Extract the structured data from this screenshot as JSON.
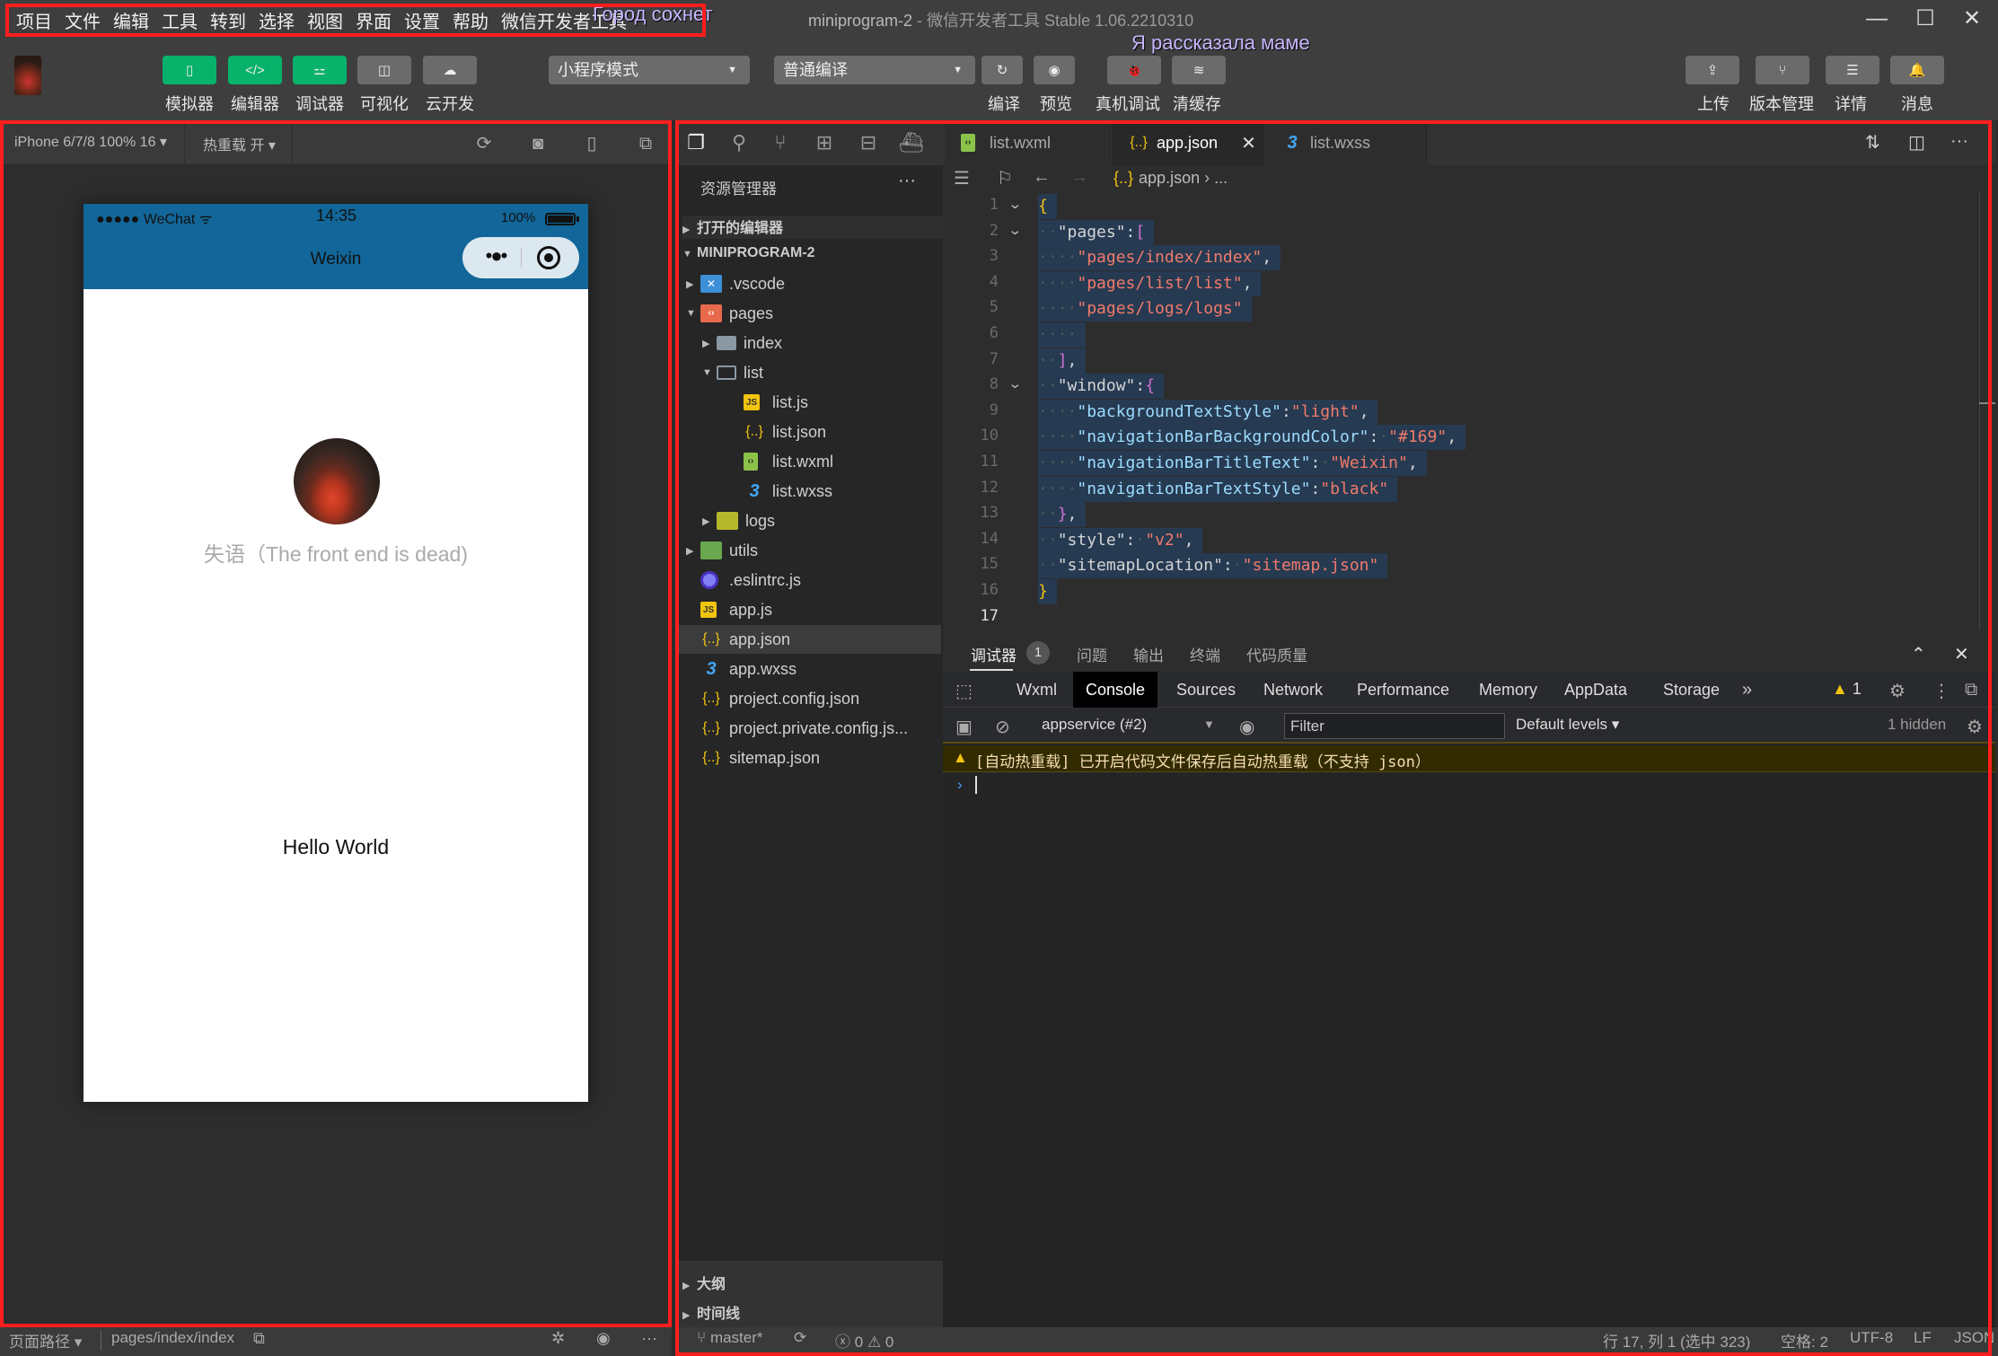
{
  "menu": {
    "items": [
      "项目",
      "文件",
      "编辑",
      "工具",
      "转到",
      "选择",
      "视图",
      "界面",
      "设置",
      "帮助",
      "微信开发者工具"
    ]
  },
  "window": {
    "project": "miniprogram-2",
    "app_title": " - 微信开发者工具 Stable 1.06.2210310",
    "minimize": "—",
    "maximize": "☐",
    "close": "✕"
  },
  "overlays": {
    "text1": "Город сохнет",
    "text2": "Я рассказала маме"
  },
  "toolbar": {
    "left_buttons": [
      {
        "label": "模拟器",
        "icon": "phone-icon",
        "glyph": "▯",
        "active": true
      },
      {
        "label": "编辑器",
        "icon": "code-icon",
        "glyph": "</>",
        "active": true
      },
      {
        "label": "调试器",
        "icon": "debugger-icon",
        "glyph": "⚍",
        "active": true
      },
      {
        "label": "可视化",
        "icon": "layout-icon",
        "glyph": "◫",
        "active": false
      },
      {
        "label": "云开发",
        "icon": "cloud-icon",
        "glyph": "☁",
        "active": false
      }
    ],
    "mode_select": "小程序模式",
    "compile_select": "普通编译",
    "action_buttons": [
      {
        "label": "编译",
        "icon": "refresh-icon",
        "glyph": "↻"
      },
      {
        "label": "预览",
        "icon": "eye-icon",
        "glyph": "◉"
      },
      {
        "label": "真机调试",
        "icon": "bug-icon",
        "glyph": "🐞"
      },
      {
        "label": "清缓存",
        "icon": "layers-icon",
        "glyph": "≋"
      }
    ],
    "right_buttons": [
      {
        "label": "上传",
        "icon": "upload-icon",
        "glyph": "⇪"
      },
      {
        "label": "版本管理",
        "icon": "branch-icon",
        "glyph": "⑂"
      },
      {
        "label": "详情",
        "icon": "menu-icon",
        "glyph": "☰"
      },
      {
        "label": "消息",
        "icon": "bell-icon",
        "glyph": "🔔"
      }
    ]
  },
  "simulator": {
    "device": "iPhone 6/7/8 100% 16 ▾",
    "hot_reload": "热重载 开 ▾",
    "status_signal": "●●●●● WeChat",
    "status_time": "14:35",
    "status_battery": "100%",
    "nav_title": "Weixin",
    "nav_color": "#126699",
    "subtitle": "失语（The front end is dead)",
    "hello": "Hello World",
    "footer_path_label": "页面路径 ▾",
    "footer_path": "pages/index/index"
  },
  "explorer": {
    "title": "资源管理器",
    "more": "···",
    "open_editors": "打开的编辑器",
    "project": "MINIPROGRAM-2",
    "tree": [
      {
        "name": ".vscode",
        "type": "folder-vscode",
        "depth": 0,
        "expanded": false
      },
      {
        "name": "pages",
        "type": "folder-pages",
        "depth": 0,
        "expanded": true
      },
      {
        "name": "index",
        "type": "folder",
        "depth": 1,
        "expanded": false
      },
      {
        "name": "list",
        "type": "folder-open",
        "depth": 1,
        "expanded": true
      },
      {
        "name": "list.js",
        "type": "js",
        "depth": 2
      },
      {
        "name": "list.json",
        "type": "json",
        "depth": 2
      },
      {
        "name": "list.wxml",
        "type": "wxml",
        "depth": 2
      },
      {
        "name": "list.wxss",
        "type": "wxss",
        "depth": 2
      },
      {
        "name": "logs",
        "type": "folder-logs",
        "depth": 1,
        "expanded": false
      },
      {
        "name": "utils",
        "type": "folder-utils",
        "depth": 0,
        "expanded": false
      },
      {
        "name": ".eslintrc.js",
        "type": "eslint",
        "depth": 0
      },
      {
        "name": "app.js",
        "type": "js",
        "depth": 0
      },
      {
        "name": "app.json",
        "type": "json",
        "depth": 0,
        "selected": true
      },
      {
        "name": "app.wxss",
        "type": "wxss",
        "depth": 0
      },
      {
        "name": "project.config.json",
        "type": "json",
        "depth": 0
      },
      {
        "name": "project.private.config.js...",
        "type": "json",
        "depth": 0
      },
      {
        "name": "sitemap.json",
        "type": "json",
        "depth": 0
      }
    ],
    "outline": "大纲",
    "timeline": "时间线"
  },
  "editor": {
    "tabs": [
      {
        "label": "list.wxml",
        "icon": "wxml-file-icon",
        "active": false
      },
      {
        "label": "app.json",
        "icon": "json-file-icon",
        "active": true
      },
      {
        "label": "list.wxss",
        "icon": "wxss-file-icon",
        "active": false
      }
    ],
    "breadcrumb": "app.json › ...",
    "current_line": 17,
    "lines": [
      [
        [
          "c-brace",
          "{"
        ]
      ],
      [
        [
          "c-ws",
          "··"
        ],
        [
          "c-key2",
          "\"pages\""
        ],
        [
          "c-key2",
          ":"
        ],
        [
          "c-bracket",
          "["
        ]
      ],
      [
        [
          "c-ws",
          "····"
        ],
        [
          "c-str",
          "\"pages/index/index\""
        ],
        [
          "c-key2",
          ","
        ]
      ],
      [
        [
          "c-ws",
          "····"
        ],
        [
          "c-str",
          "\"pages/list/list\""
        ],
        [
          "c-key2",
          ","
        ]
      ],
      [
        [
          "c-ws",
          "····"
        ],
        [
          "c-str",
          "\"pages/logs/logs\""
        ]
      ],
      [
        [
          "c-ws",
          "····"
        ]
      ],
      [
        [
          "c-ws",
          "··"
        ],
        [
          "c-bracket",
          "]"
        ],
        [
          "c-key2",
          ","
        ]
      ],
      [
        [
          "c-ws",
          "··"
        ],
        [
          "c-key2",
          "\"window\""
        ],
        [
          "c-key2",
          ":"
        ],
        [
          "c-bracket",
          "{"
        ]
      ],
      [
        [
          "c-ws",
          "····"
        ],
        [
          "c-key",
          "\"backgroundTextStyle\""
        ],
        [
          "c-key2",
          ":"
        ],
        [
          "c-str",
          "\"light\""
        ],
        [
          "c-key2",
          ","
        ]
      ],
      [
        [
          "c-ws",
          "····"
        ],
        [
          "c-key",
          "\"navigationBarBackgroundColor\""
        ],
        [
          "c-key2",
          ":"
        ],
        [
          "c-ws",
          "·"
        ],
        [
          "c-str",
          "\"#169\""
        ],
        [
          "c-key2",
          ","
        ]
      ],
      [
        [
          "c-ws",
          "····"
        ],
        [
          "c-key",
          "\"navigationBarTitleText\""
        ],
        [
          "c-key2",
          ":"
        ],
        [
          "c-ws",
          "·"
        ],
        [
          "c-str",
          "\"Weixin\""
        ],
        [
          "c-key2",
          ","
        ]
      ],
      [
        [
          "c-ws",
          "····"
        ],
        [
          "c-key",
          "\"navigationBarTextStyle\""
        ],
        [
          "c-key2",
          ":"
        ],
        [
          "c-str",
          "\"black\""
        ]
      ],
      [
        [
          "c-ws",
          "··"
        ],
        [
          "c-bracket",
          "}"
        ],
        [
          "c-key2",
          ","
        ]
      ],
      [
        [
          "c-ws",
          "··"
        ],
        [
          "c-key2",
          "\"style\""
        ],
        [
          "c-key2",
          ":"
        ],
        [
          "c-ws",
          "·"
        ],
        [
          "c-str",
          "\"v2\""
        ],
        [
          "c-key2",
          ","
        ]
      ],
      [
        [
          "c-ws",
          "··"
        ],
        [
          "c-key2",
          "\"sitemapLocation\""
        ],
        [
          "c-key2",
          ":"
        ],
        [
          "c-ws",
          "·"
        ],
        [
          "c-str",
          "\"sitemap.json\""
        ]
      ],
      [
        [
          "c-brace",
          "}"
        ]
      ],
      []
    ],
    "foldable_lines": [
      1,
      2,
      8
    ]
  },
  "debugger": {
    "tabs": [
      "调试器",
      "问题",
      "输出",
      "终端",
      "代码质量"
    ],
    "badge": "1",
    "devtools_tabs": [
      "Wxml",
      "Console",
      "Sources",
      "Network",
      "Performance",
      "Memory",
      "AppData",
      "Storage"
    ],
    "active_devtools_tab": "Console",
    "more_tabs": "»",
    "warn_count": "1",
    "context": "appservice (#2)",
    "filter_placeholder": "Filter",
    "levels": "Default levels ▾",
    "hidden": "1 hidden",
    "warning_message": "[自动热重载] 已开启代码文件保存后自动热重载（不支持 json）",
    "prompt": "›"
  },
  "statusbar": {
    "branch": "master*",
    "errors": "0",
    "warnings": "0",
    "cursor": "行 17, 列 1 (选中 323)",
    "indent": "空格: 2",
    "encoding": "UTF-8",
    "eol": "LF",
    "language": "JSON"
  }
}
